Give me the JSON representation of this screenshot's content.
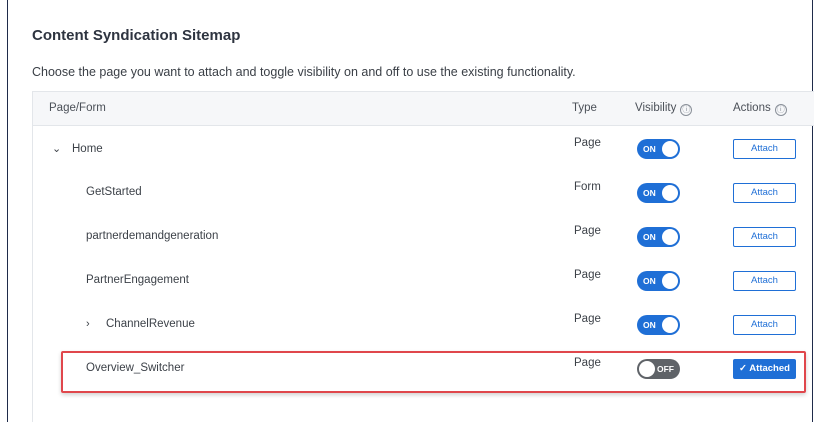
{
  "title": "Content Syndication Sitemap",
  "description": "Choose the page you want to attach and toggle visibility on and off to use the existing functionality.",
  "columns": {
    "page": "Page/Form",
    "type": "Type",
    "visibility": "Visibility",
    "actions": "Actions",
    "info_icon": "ⓘ"
  },
  "rows": [
    {
      "name": "Home",
      "chevron": "⌄",
      "type": "Page",
      "visibility": "ON",
      "action": "Attach"
    },
    {
      "name": "GetStarted",
      "chevron": "",
      "type": "Form",
      "visibility": "ON",
      "action": "Attach"
    },
    {
      "name": "partnerdemandgeneration",
      "chevron": "",
      "type": "Page",
      "visibility": "ON",
      "action": "Attach"
    },
    {
      "name": "PartnerEngagement",
      "chevron": "",
      "type": "Page",
      "visibility": "ON",
      "action": "Attach"
    },
    {
      "name": "ChannelRevenue",
      "chevron": "›",
      "type": "Page",
      "visibility": "ON",
      "action": "Attach"
    },
    {
      "name": "Overview_Switcher",
      "chevron": "",
      "type": "Page",
      "visibility": "OFF",
      "action": "✓ Attached"
    }
  ],
  "colors": {
    "accent": "#1f6fd6",
    "toggle_off": "#5f6368",
    "highlight": "#e0474c"
  }
}
